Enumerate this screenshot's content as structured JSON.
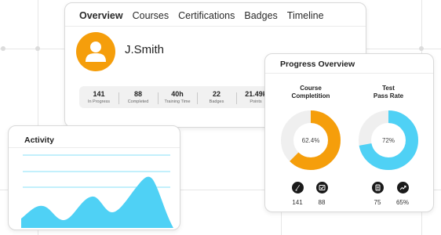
{
  "colors": {
    "accent_orange": "#f59e0b",
    "accent_blue": "#4fd1f5",
    "donut_track": "#efefef",
    "chart_line": "#9fe7fa"
  },
  "tabs": [
    {
      "label": "Overview",
      "active": true
    },
    {
      "label": "Courses",
      "active": false
    },
    {
      "label": "Certifications",
      "active": false
    },
    {
      "label": "Badges",
      "active": false
    },
    {
      "label": "Timeline",
      "active": false
    }
  ],
  "profile": {
    "name": "J.Smith",
    "avatar_icon": "user-avatar-icon"
  },
  "stats": [
    {
      "value": "141",
      "label": "In Progress"
    },
    {
      "value": "88",
      "label": "Completed"
    },
    {
      "value": "40h",
      "label": "Training Time"
    },
    {
      "value": "22",
      "label": "Badges"
    },
    {
      "value": "21.49k",
      "label": "Points"
    }
  ],
  "progress": {
    "title": "Progress Overview",
    "course_completion": {
      "title_line1": "Course",
      "title_line2": "Completition",
      "value_label": "62.4%",
      "fraction": 0.624,
      "icons": [
        {
          "name": "in-progress-icon",
          "count": "141"
        },
        {
          "name": "completed-icon",
          "count": "88"
        }
      ]
    },
    "test_pass_rate": {
      "title_line1": "Test",
      "title_line2": "Pass Rate",
      "value_label": "72%",
      "fraction": 0.72,
      "icons": [
        {
          "name": "tests-icon",
          "count": "75"
        },
        {
          "name": "trend-up-icon",
          "count": "65%"
        }
      ]
    }
  },
  "activity": {
    "title": "Activity"
  }
}
